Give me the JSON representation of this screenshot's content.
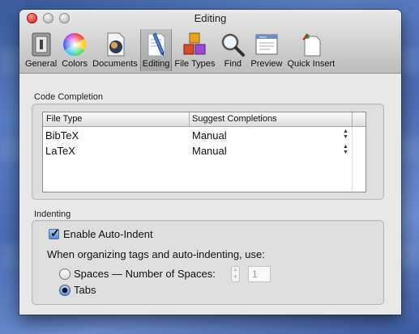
{
  "window": {
    "title": "Editing"
  },
  "toolbar": {
    "items": [
      {
        "label": "General"
      },
      {
        "label": "Colors"
      },
      {
        "label": "Documents"
      },
      {
        "label": "Editing"
      },
      {
        "label": "File Types"
      },
      {
        "label": "Find"
      },
      {
        "label": "Preview"
      },
      {
        "label": "Quick Insert"
      }
    ],
    "selected": "Editing"
  },
  "code_completion": {
    "title": "Code Completion",
    "columns": [
      "File Type",
      "Suggest Completions"
    ],
    "rows": [
      {
        "file_type": "BibTeX",
        "suggest": "Manual"
      },
      {
        "file_type": "LaTeX",
        "suggest": "Manual"
      }
    ]
  },
  "indenting": {
    "title": "Indenting",
    "auto_indent_label": "Enable Auto-Indent",
    "auto_indent_checked": true,
    "use_label": "When organizing tags and auto-indenting, use:",
    "spaces_label": "Spaces — Number of Spaces:",
    "spaces_value": "1",
    "tabs_label": "Tabs",
    "selected": "Tabs"
  }
}
